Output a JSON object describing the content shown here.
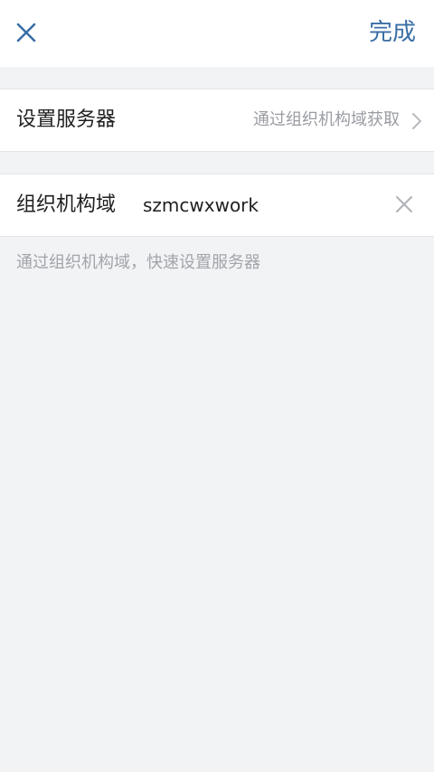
{
  "header": {
    "close_icon": "close-icon",
    "done_label": "完成",
    "accent_color": "#3a6ea5"
  },
  "server_row": {
    "label": "设置服务器",
    "value": "通过组织机构域获取",
    "chevron_icon": "chevron-right-icon"
  },
  "domain_row": {
    "label": "组织机构域",
    "input_value": "szmcwxwork",
    "clear_icon": "clear-icon"
  },
  "hint": {
    "text": "通过组织机构域，快速设置服务器"
  }
}
